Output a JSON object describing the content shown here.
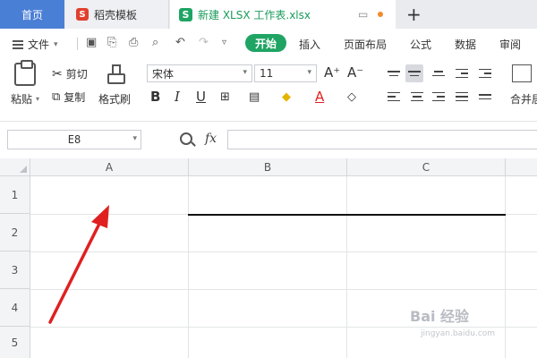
{
  "tabs": {
    "home": "首页",
    "template": "稻壳模板",
    "document": "新建 XLSX 工作表.xlsx",
    "template_icon": "S",
    "doc_icon": "S"
  },
  "menu": {
    "file": "文件",
    "items": [
      "开始",
      "插入",
      "页面布局",
      "公式",
      "数据",
      "审阅"
    ]
  },
  "ribbon": {
    "paste": "粘贴",
    "cut": "剪切",
    "copy": "复制",
    "format_painter": "格式刷",
    "font_name": "宋体",
    "font_size": "11",
    "grow_font": "A⁺",
    "shrink_font": "A⁻",
    "bold": "B",
    "italic": "I",
    "underline": "U",
    "font_color": "A",
    "merge": "合并居"
  },
  "formula_bar": {
    "cell_ref": "E8",
    "fx": "fx",
    "value": ""
  },
  "sheet": {
    "columns": [
      "A",
      "B",
      "C"
    ],
    "rows": [
      "1",
      "2",
      "3",
      "4",
      "5"
    ]
  },
  "watermark": {
    "text": "Bai 经验",
    "url": "jingyan.baidu.com"
  },
  "colors": {
    "accent_green": "#1fa463",
    "home_tab": "#4a7fd6",
    "arrow_red": "#e02020"
  }
}
